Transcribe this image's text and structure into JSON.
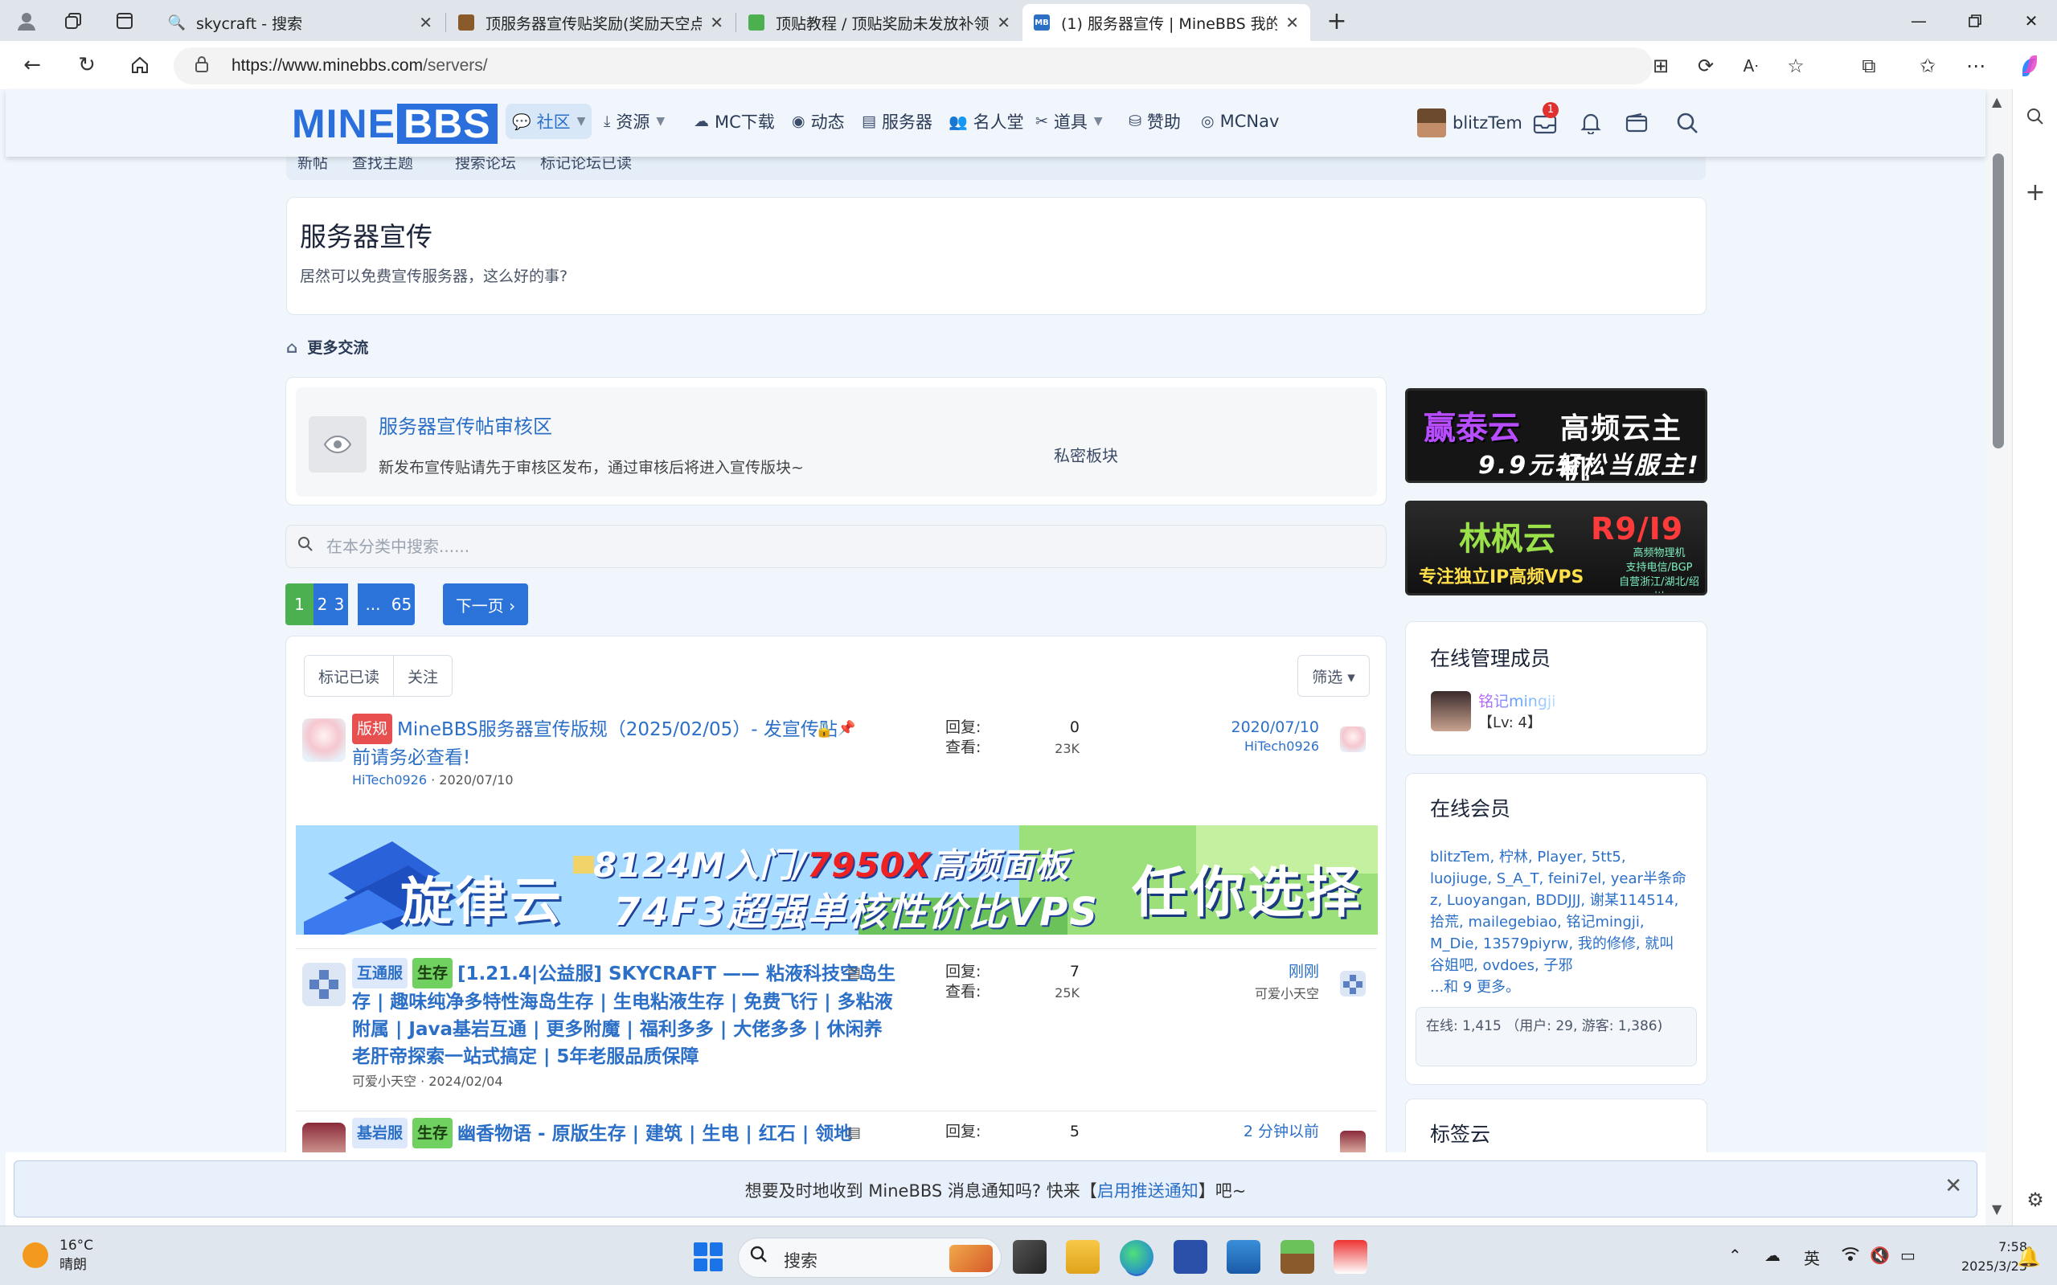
{
  "browser": {
    "tabs": [
      {
        "title": "skycraft - 搜索",
        "close": "✕"
      },
      {
        "title": "顶服务器宣传贴奖励(奖励天空点卡)",
        "close": "✕"
      },
      {
        "title": "顶贴教程 / 顶贴奖励未发放补领",
        "close": "✕"
      },
      {
        "title": "(1) 服务器宣传 | MineBBS 我的世界",
        "close": "✕"
      }
    ],
    "url_host": "https://www.minebbs.com",
    "url_path": "/servers/",
    "favicon_mb": "MB"
  },
  "site": {
    "logo_mine": "MINE",
    "logo_bbs": "BBS",
    "nav": [
      {
        "label": "社区",
        "icon": "chat-icon"
      },
      {
        "label": "资源",
        "icon": "download-icon"
      },
      {
        "label": "MC下载",
        "icon": "cloud-icon"
      },
      {
        "label": "动态",
        "icon": "broadcast-icon"
      },
      {
        "label": "服务器",
        "icon": "server-icon"
      },
      {
        "label": "名人堂",
        "icon": "users-icon"
      },
      {
        "label": "道具",
        "icon": "tools-icon"
      },
      {
        "label": "赞助",
        "icon": "donate-icon"
      },
      {
        "label": "MCNav",
        "icon": "compass-icon"
      }
    ],
    "user_name": "blitzTem",
    "inbox_badge": "1",
    "subnav": [
      "新帖",
      "查找主题",
      "搜索论坛",
      "标记论坛已读"
    ]
  },
  "page": {
    "title": "服务器宣传",
    "description": "居然可以免费宣传服务器，这么好的事?",
    "breadcrumb": "更多交流",
    "subforum": {
      "title": "服务器宣传帖审核区",
      "description": "新发布宣传贴请先于审核区发布，通过审核后将进入宣传版块~",
      "status": "私密板块"
    },
    "search_placeholder": "在本分类中搜索......",
    "pages": [
      "1",
      "2",
      "3",
      "...",
      "65"
    ],
    "next_label": "下一页 ›",
    "toolbar": {
      "mark_read": "标记已读",
      "watch": "关注",
      "filter": "筛选 ▾"
    },
    "stat_labels": {
      "replies": "回复:",
      "views": "查看:"
    }
  },
  "threads": [
    {
      "prefix": "版规",
      "title": "MineBBS服务器宣传版规（2025/02/05）- 发宣传贴前请务必查看!",
      "author": "HiTech0926",
      "date": "2020/07/10",
      "replies": "0",
      "views": "23K",
      "last_date": "2020/07/10",
      "last_by": "HiTech0926"
    },
    {
      "prefix1": "互通服",
      "prefix2": "生存",
      "title": "[1.21.4|公益服] SKYCRAFT —— 粘液科技空岛生存 | 趣味纯净多特性海岛生存 | 生电粘液生存 | 免费飞行 | 多粘液附属 | Java基岩互通 | 更多附魔 | 福利多多 | 大佬多多 | 休闲养老肝帝探索一站式搞定 | 5年老服品质保障",
      "author": "可爱小天空",
      "date": "2024/02/04",
      "replies": "7",
      "views": "25K",
      "last_date": "刚刚",
      "last_by": "可爱小天空"
    },
    {
      "prefix1": "基岩服",
      "prefix2": "生存",
      "title": "幽香物语 - 原版生存 | 建筑 | 生电 | 红石 | 领地",
      "replies": "5",
      "last_date": "2 分钟以前"
    }
  ],
  "banner": {
    "brand": "旋律云",
    "line1_a": "8124M入门/",
    "line1_b": "7950X",
    "line1_c": "高频面板",
    "line2": "74F3超强单核性价比VPS",
    "slogan": "任你选择"
  },
  "ads": [
    {
      "brand": "赢泰云",
      "headline": "高频云主机",
      "sub": "9.9元轻松当服主!"
    },
    {
      "brand": "林枫云",
      "price": "R9/I9",
      "line": "专注独立IP高频VPS",
      "detail1": "高频物理机",
      "detail2": "支持电信/BGP",
      "detail3": "自营浙江/湖北/绍川"
    }
  ],
  "sidebar": {
    "staff_title": "在线管理成员",
    "staff_name": "铭记mingji",
    "staff_level": "【Lv: 4】",
    "online_title": "在线会员",
    "online_members": "blitzTem, 柠林, Player, 5tt5, luojiuge, S_A_T, feini7el, year半条命z, Luoyangan, BDDJJJ, 谢某114514, 拾荒, mailegebiao, 铭记mingji, M_Die, 13579piyrw, 我的修修, 就叫谷姐吧, ovdoes, 子邪",
    "online_more": "...和 9 更多。",
    "online_stats": "在线: 1,415 （用户: 29, 游客: 1,386)",
    "tags_title": "标签云"
  },
  "notification": {
    "before": "想要及时地收到 MineBBS 消息通知吗? 快来【",
    "link": "启用推送通知",
    "after": "】吧~"
  },
  "taskbar": {
    "temperature": "16°C",
    "weather": "晴朗",
    "search_placeholder": "搜索",
    "ime": "英",
    "time": "7:58",
    "date": "2025/3/25"
  }
}
